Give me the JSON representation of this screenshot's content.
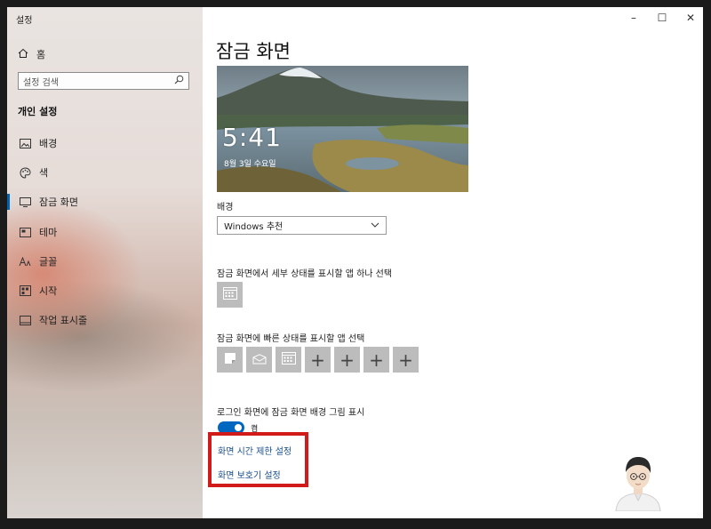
{
  "window": {
    "title": "설정",
    "controls": {
      "minimize": "–",
      "maximize": "☐",
      "close": "✕"
    }
  },
  "sidebar": {
    "home_label": "홈",
    "search_placeholder": "설정 검색",
    "section_title": "개인 설정",
    "items": [
      {
        "label": "배경",
        "icon": "image-icon"
      },
      {
        "label": "색",
        "icon": "palette-icon"
      },
      {
        "label": "잠금 화면",
        "icon": "lock-screen-icon",
        "active": true
      },
      {
        "label": "테마",
        "icon": "theme-icon"
      },
      {
        "label": "글꼴",
        "icon": "font-icon"
      },
      {
        "label": "시작",
        "icon": "start-icon"
      },
      {
        "label": "작업 표시줄",
        "icon": "taskbar-icon"
      }
    ]
  },
  "main": {
    "title": "잠금 화면",
    "preview": {
      "time": "5:41",
      "date": "8월 3일 수요일"
    },
    "background_label": "배경",
    "background_value": "Windows 추천",
    "detail_status_label": "잠금 화면에서 세부 상태를 표시할 앱 하나 선택",
    "quick_status_label": "잠금 화면에 빠른 상태를 표시할 앱 선택",
    "signin_bg_label": "로그인 화면에 잠금 화면 배경 그림 표시",
    "toggle_state": "켬",
    "link_timeout": "화면 시간 제한 설정",
    "link_screensaver": "화면 보호기 설정"
  },
  "colors": {
    "accent": "#0067c0",
    "highlight_box": "#d11a1a",
    "link": "#1a4f8b"
  }
}
